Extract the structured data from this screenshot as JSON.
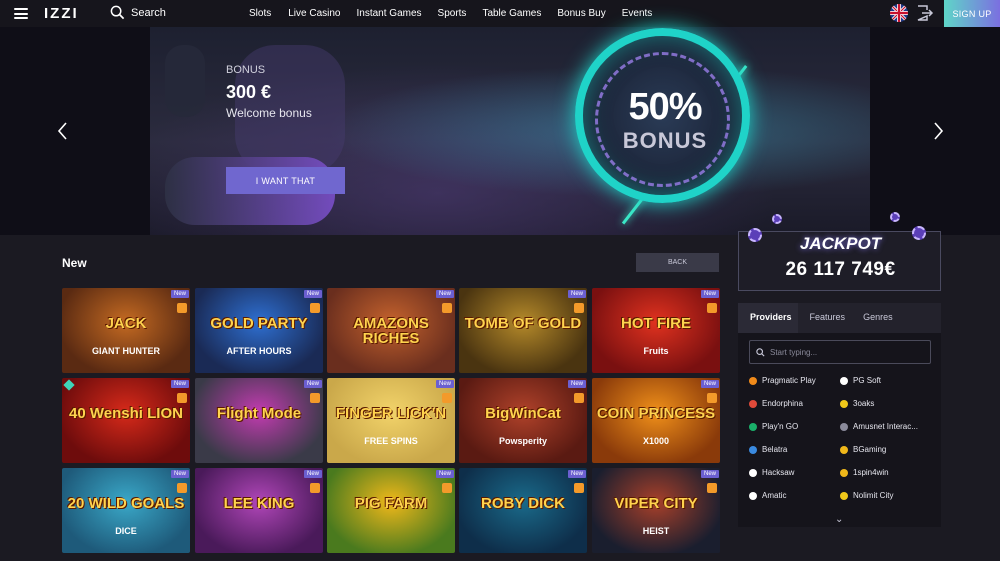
{
  "header": {
    "logo": "IZZI",
    "search_label": "Search",
    "nav": [
      "Slots",
      "Live Casino",
      "Instant Games",
      "Sports",
      "Table Games",
      "Bonus Buy",
      "Events"
    ],
    "signup": "SIGN UP"
  },
  "hero": {
    "label": "BONUS",
    "amount": "300 €",
    "subtitle": "Welcome bonus",
    "button": "I WANT THAT",
    "graphic_percent": "50%",
    "graphic_word": "BONUS"
  },
  "section": {
    "title": "New",
    "back_button": "BACK",
    "badge_new": "New"
  },
  "games": [
    {
      "title": "JACK",
      "sub": "GIANT HUNTER",
      "bg": "#5a2a12",
      "accent": "#c46a22",
      "new": true,
      "gem": false
    },
    {
      "title": "GOLD PARTY",
      "sub": "AFTER HOURS",
      "bg": "#1a2a55",
      "accent": "#2e6fd1",
      "new": true,
      "gem": false
    },
    {
      "title": "AMAZONS RICHES",
      "sub": "",
      "bg": "#6a2e1e",
      "accent": "#c4622d",
      "new": true,
      "gem": false
    },
    {
      "title": "TOMB OF GOLD",
      "sub": "",
      "bg": "#4a3410",
      "accent": "#b58a2a",
      "new": true,
      "gem": false
    },
    {
      "title": "HOT FIRE",
      "sub": "Fruits",
      "bg": "#7a1010",
      "accent": "#e0321f",
      "new": true,
      "gem": false
    },
    {
      "title": "40 Wenshi LION",
      "sub": "",
      "bg": "#6e0c0c",
      "accent": "#d72a1a",
      "new": true,
      "gem": true
    },
    {
      "title": "Flight Mode",
      "sub": "",
      "bg": "#3a3a48",
      "accent": "#c23bb0",
      "new": true,
      "gem": false
    },
    {
      "title": "FINGER LICK'N",
      "sub": "FREE SPINS",
      "bg": "#caa84a",
      "accent": "#f2d36a",
      "new": true,
      "gem": false
    },
    {
      "title": "BigWinCat",
      "sub": "Powsperity",
      "bg": "#5a1a12",
      "accent": "#b0422a",
      "new": true,
      "gem": false
    },
    {
      "title": "COIN PRINCESS",
      "sub": "X1000",
      "bg": "#8a3a0a",
      "accent": "#f0901a",
      "new": true,
      "gem": false
    },
    {
      "title": "20 WILD GOALS",
      "sub": "DICE",
      "bg": "#1e5a7a",
      "accent": "#3aa8c8",
      "new": true,
      "gem": false
    },
    {
      "title": "LEE KING",
      "sub": "",
      "bg": "#4a1a5a",
      "accent": "#b046b8",
      "new": true,
      "gem": false
    },
    {
      "title": "PIG FARM",
      "sub": "",
      "bg": "#4a7a1e",
      "accent": "#f0b81a",
      "new": true,
      "gem": false
    },
    {
      "title": "ROBY DICK",
      "sub": "",
      "bg": "#0e2e4a",
      "accent": "#1a6a8a",
      "new": true,
      "gem": false
    },
    {
      "title": "VIPER CITY",
      "sub": "HEIST",
      "bg": "#1a1e2e",
      "accent": "#a8402a",
      "new": true,
      "gem": false
    }
  ],
  "jackpot": {
    "label": "JACKPOT",
    "amount": "26 117 749€"
  },
  "providers_panel": {
    "tabs": [
      "Providers",
      "Features",
      "Genres"
    ],
    "search_placeholder": "Start typing...",
    "providers": [
      {
        "name": "Pragmatic Play",
        "color": "#f08a1a"
      },
      {
        "name": "PG Soft",
        "color": "#ffffff"
      },
      {
        "name": "Endorphina",
        "color": "#e04a3a"
      },
      {
        "name": "3oaks",
        "color": "#f0c81a"
      },
      {
        "name": "Play'n GO",
        "color": "#1ab06a"
      },
      {
        "name": "Amusnet Interac...",
        "color": "#8a8a9a"
      },
      {
        "name": "Belatra",
        "color": "#3a8ae0"
      },
      {
        "name": "BGaming",
        "color": "#f0b81a"
      },
      {
        "name": "Hacksaw",
        "color": "#ffffff"
      },
      {
        "name": "1spin4win",
        "color": "#f0b81a"
      },
      {
        "name": "Amatic",
        "color": "#ffffff"
      },
      {
        "name": "Nolimit City",
        "color": "#f0c81a"
      }
    ]
  }
}
